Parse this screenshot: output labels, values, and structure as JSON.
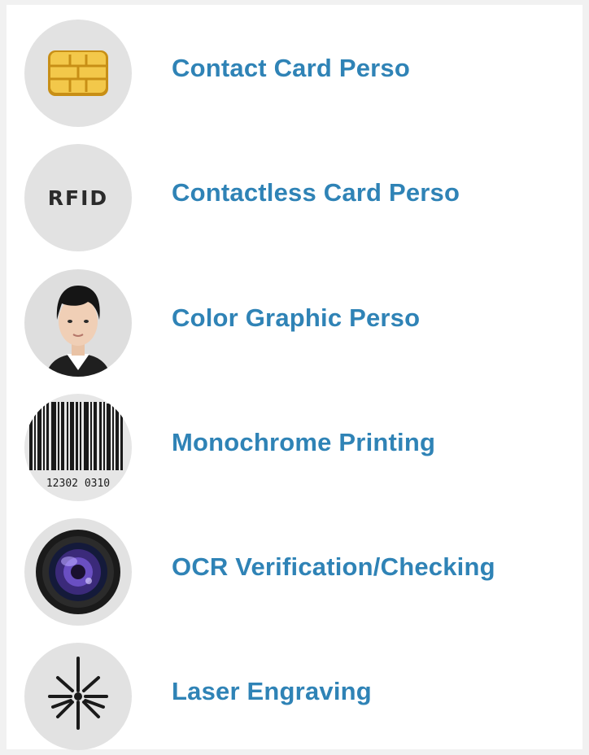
{
  "items": [
    {
      "label": "Contact Card Perso",
      "icon": "chip-icon"
    },
    {
      "label": "Contactless Card Perso",
      "icon": "rfid-icon",
      "icon_text": "RFID"
    },
    {
      "label": "Color Graphic Perso",
      "icon": "portrait-icon"
    },
    {
      "label": "Monochrome Printing",
      "icon": "barcode-icon",
      "icon_text": "12302 0310"
    },
    {
      "label": "OCR Verification/Checking",
      "icon": "camera-lens-icon"
    },
    {
      "label": "Laser Engraving",
      "icon": "laser-icon"
    }
  ],
  "colors": {
    "label": "#2f83b6",
    "circle": "#e2e2e2",
    "background": "#ffffff"
  }
}
